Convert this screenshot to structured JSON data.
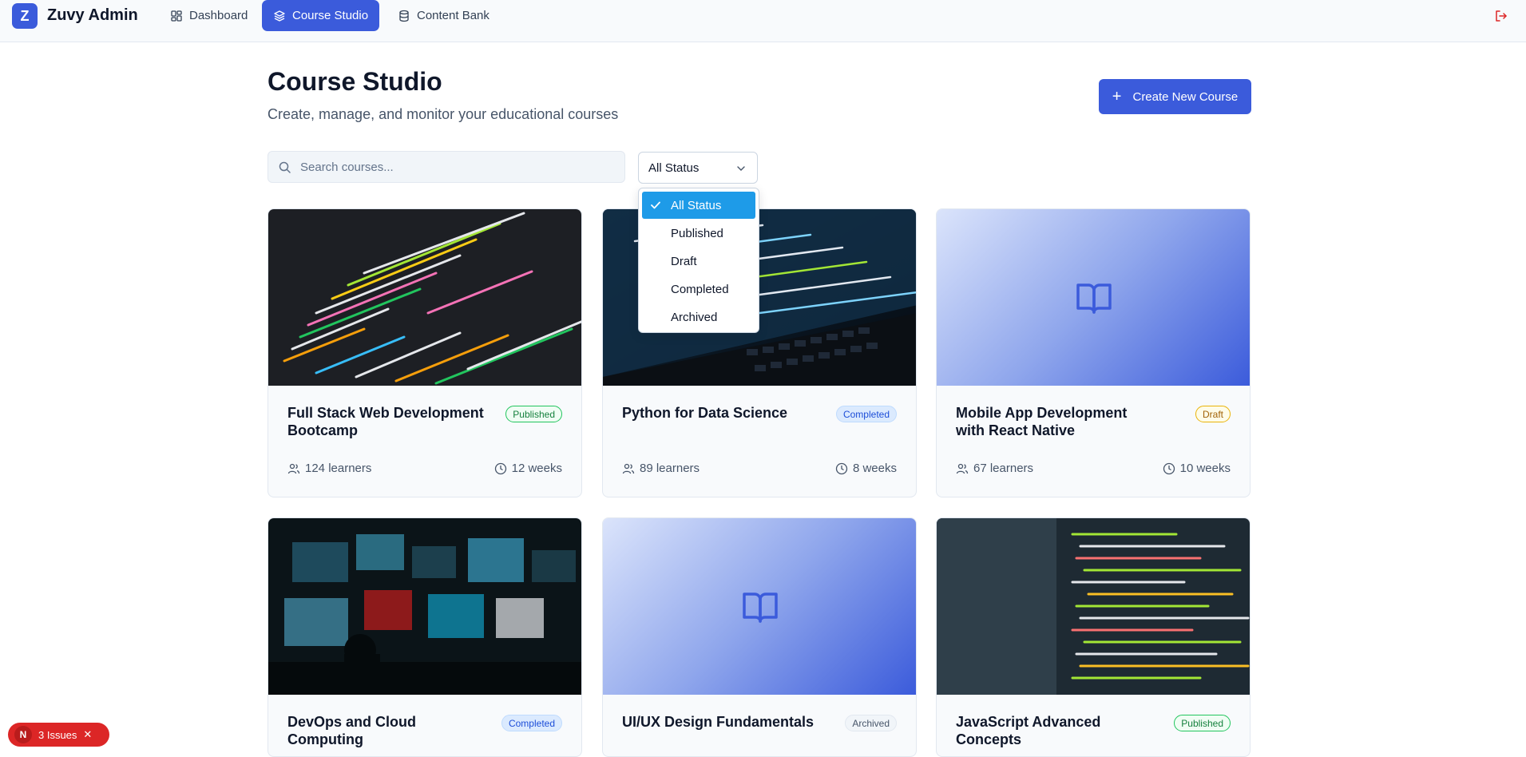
{
  "brand": {
    "logo_letter": "Z",
    "name": "Zuvy Admin"
  },
  "nav": {
    "items": [
      {
        "label": "Dashboard",
        "icon": "dashboard-icon",
        "active": false
      },
      {
        "label": "Course Studio",
        "icon": "layers-icon",
        "active": true
      },
      {
        "label": "Content Bank",
        "icon": "database-icon",
        "active": false
      }
    ],
    "logout_icon": "logout-icon"
  },
  "header": {
    "title": "Course Studio",
    "subtitle": "Create, manage, and monitor your educational courses",
    "create_button": "Create New Course"
  },
  "filters": {
    "search_placeholder": "Search courses...",
    "search_value": "",
    "status_selected": "All Status",
    "status_options": [
      "All Status",
      "Published",
      "Draft",
      "Completed",
      "Archived"
    ]
  },
  "courses": [
    {
      "title": "Full Stack Web Development Bootcamp",
      "status": "Published",
      "learners": "124 learners",
      "duration": "12 weeks"
    },
    {
      "title": "Python for Data Science",
      "status": "Completed",
      "learners": "89 learners",
      "duration": "8 weeks"
    },
    {
      "title": "Mobile App Development with React Native",
      "status": "Draft",
      "learners": "67 learners",
      "duration": "10 weeks"
    },
    {
      "title": "DevOps and Cloud Computing",
      "status": "Completed",
      "learners": "",
      "duration": ""
    },
    {
      "title": "UI/UX Design Fundamentals",
      "status": "Archived",
      "learners": "",
      "duration": ""
    },
    {
      "title": "JavaScript Advanced Concepts",
      "status": "Published",
      "learners": "",
      "duration": ""
    }
  ],
  "issues_badge": {
    "letter": "N",
    "label": "3 Issues"
  },
  "colors": {
    "accent": "#3b5bdb",
    "dropdown_selected": "#1e9be8",
    "issues": "#dc2626"
  }
}
